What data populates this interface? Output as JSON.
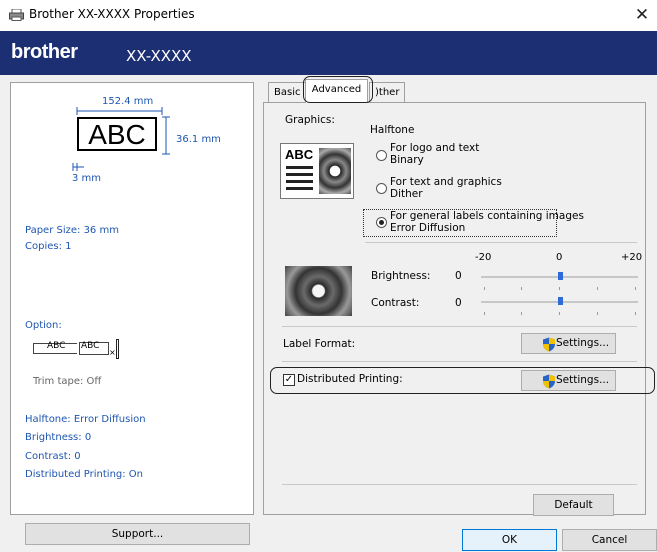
{
  "window": {
    "title": "Brother XX-XXXX  Properties",
    "close_glyph": "✕"
  },
  "brand": {
    "logo": "brother",
    "model": "XX-XXXX"
  },
  "preview": {
    "width_measure": "152.4 mm",
    "sample_text": "ABC",
    "height_measure": "36.1 mm",
    "margin_measure": "3 mm",
    "paper_size": "Paper Size: 36 mm",
    "copies": "Copies: 1",
    "option_label": "Option:",
    "option_icon_text_1": "ABC",
    "option_icon_text_2": "ABC",
    "trim_tape": "Trim tape: Off",
    "halftone": "Halftone: Error Diffusion",
    "brightness": "Brightness:  0",
    "contrast": "Contrast:  0",
    "distributed_printing": "Distributed Printing: On"
  },
  "tabs": {
    "basic": "Basic",
    "advanced": "Advanced",
    "other": ")ther"
  },
  "graphics": {
    "label": "Graphics:",
    "halftone_label": "Halftone",
    "thumbnail_text": "ABC",
    "options": [
      {
        "line1": "For logo and text",
        "line2": "Binary",
        "checked": false
      },
      {
        "line1": "For text and graphics",
        "line2": "Dither",
        "checked": false
      },
      {
        "line1": "For general labels containing images",
        "line2": "Error Diffusion",
        "checked": true
      }
    ]
  },
  "sliders": {
    "scale_min": "-20",
    "scale_mid": "0",
    "scale_max": "+20",
    "brightness_label": "Brightness:",
    "brightness_value": "0",
    "contrast_label": "Contrast:",
    "contrast_value": "0",
    "brightness_level": 0,
    "contrast_level": 0
  },
  "label_format": {
    "label": "Label Format:",
    "settings_button": "Settings..."
  },
  "distributed": {
    "label": "Distributed Printing:",
    "checked": true,
    "check_glyph": "✓",
    "settings_button": "Settings..."
  },
  "buttons": {
    "default": "Default",
    "support": "Support...",
    "ok": "OK",
    "cancel": "Cancel"
  },
  "colors": {
    "brand_bar": "#1d2f73",
    "preview_text": "#1e56b0",
    "slider_thumb": "#2f6bd8",
    "ok_border": "#0078d7"
  },
  "icons": {
    "window_icon": "printer-icon",
    "shield": "uac-shield-icon"
  }
}
